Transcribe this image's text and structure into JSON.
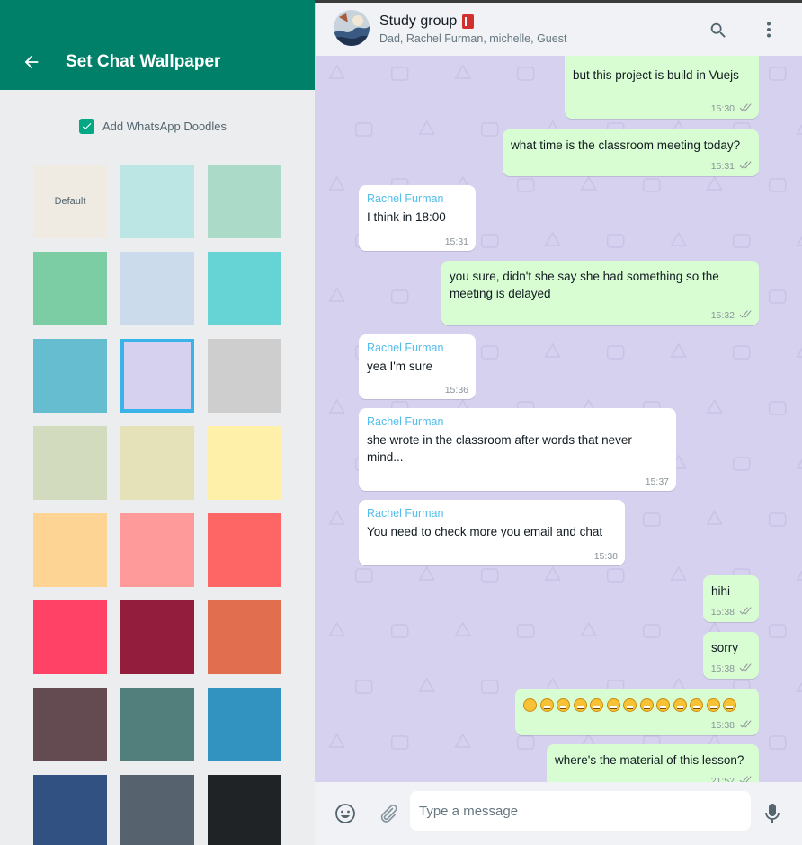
{
  "left_panel": {
    "title": "Set Chat Wallpaper",
    "doodle_label": "Add WhatsApp Doodles",
    "doodle_checked": true,
    "header_color": "#008069",
    "swatches": [
      {
        "label": "Default",
        "color": "#efeae2"
      },
      {
        "label": "",
        "color": "#bce6e4"
      },
      {
        "label": "",
        "color": "#acdac8"
      },
      {
        "label": "",
        "color": "#7ccca4"
      },
      {
        "label": "",
        "color": "#cbdbec"
      },
      {
        "label": "",
        "color": "#66d3d4"
      },
      {
        "label": "",
        "color": "#66bdd0"
      },
      {
        "label": "",
        "color": "#d6d1ef",
        "selected": true
      },
      {
        "label": "",
        "color": "#cecece"
      },
      {
        "label": "",
        "color": "#d2dbbe"
      },
      {
        "label": "",
        "color": "#e5e1b8"
      },
      {
        "label": "",
        "color": "#fff0a9"
      },
      {
        "label": "",
        "color": "#fed494"
      },
      {
        "label": "",
        "color": "#fe9b9a"
      },
      {
        "label": "",
        "color": "#fe6666"
      },
      {
        "label": "",
        "color": "#ff4266"
      },
      {
        "label": "",
        "color": "#921d3d"
      },
      {
        "label": "",
        "color": "#e06e4f"
      },
      {
        "label": "",
        "color": "#634b51"
      },
      {
        "label": "",
        "color": "#527f7b"
      },
      {
        "label": "",
        "color": "#3293c0"
      },
      {
        "label": "",
        "color": "#325183"
      },
      {
        "label": "",
        "color": "#56626e"
      },
      {
        "label": "",
        "color": "#202326"
      }
    ]
  },
  "chat_header": {
    "title": "Study group",
    "participants": "Dad, Rachel Furman, michelle, Guest"
  },
  "messages": [
    {
      "dir": "out",
      "text": "but this project is build in Vuejs",
      "time": "15:30"
    },
    {
      "dir": "out",
      "text": "what time is the classroom meeting today?",
      "time": "15:31"
    },
    {
      "dir": "in",
      "sender": "Rachel Furman",
      "text": "I think in 18:00",
      "time": "15:31"
    },
    {
      "dir": "out",
      "text": "you sure, didn't she say she had something so the meeting is delayed",
      "time": "15:32"
    },
    {
      "dir": "in",
      "sender": "Rachel Furman",
      "text": "yea I'm sure",
      "time": "15:36"
    },
    {
      "dir": "in",
      "sender": "Rachel Furman",
      "text": "she wrote in the classroom after words that never mind...",
      "time": "15:37"
    },
    {
      "dir": "in",
      "sender": "Rachel Furman",
      "text": "You need to check more you email and chat",
      "time": "15:38"
    },
    {
      "dir": "out",
      "text": "hihi",
      "time": "15:38"
    },
    {
      "dir": "out",
      "text": "sorry",
      "time": "15:38"
    },
    {
      "dir": "out",
      "emoji_count": 13,
      "time": "15:38"
    },
    {
      "dir": "out",
      "text": "where's the material of this lesson?",
      "time": "21:52"
    }
  ],
  "composer": {
    "placeholder": "Type a message"
  },
  "colors": {
    "outgoing_bubble": "#d9fdd3",
    "incoming_bubble": "#ffffff",
    "sender_name": "#53bdeb",
    "chat_background": "#d6d1ef"
  },
  "icons": [
    "back-arrow-icon",
    "checkbox-icon",
    "search-icon",
    "menu-icon",
    "double-check-icon",
    "emoji-icon",
    "attach-icon",
    "mic-icon",
    "book-icon"
  ]
}
